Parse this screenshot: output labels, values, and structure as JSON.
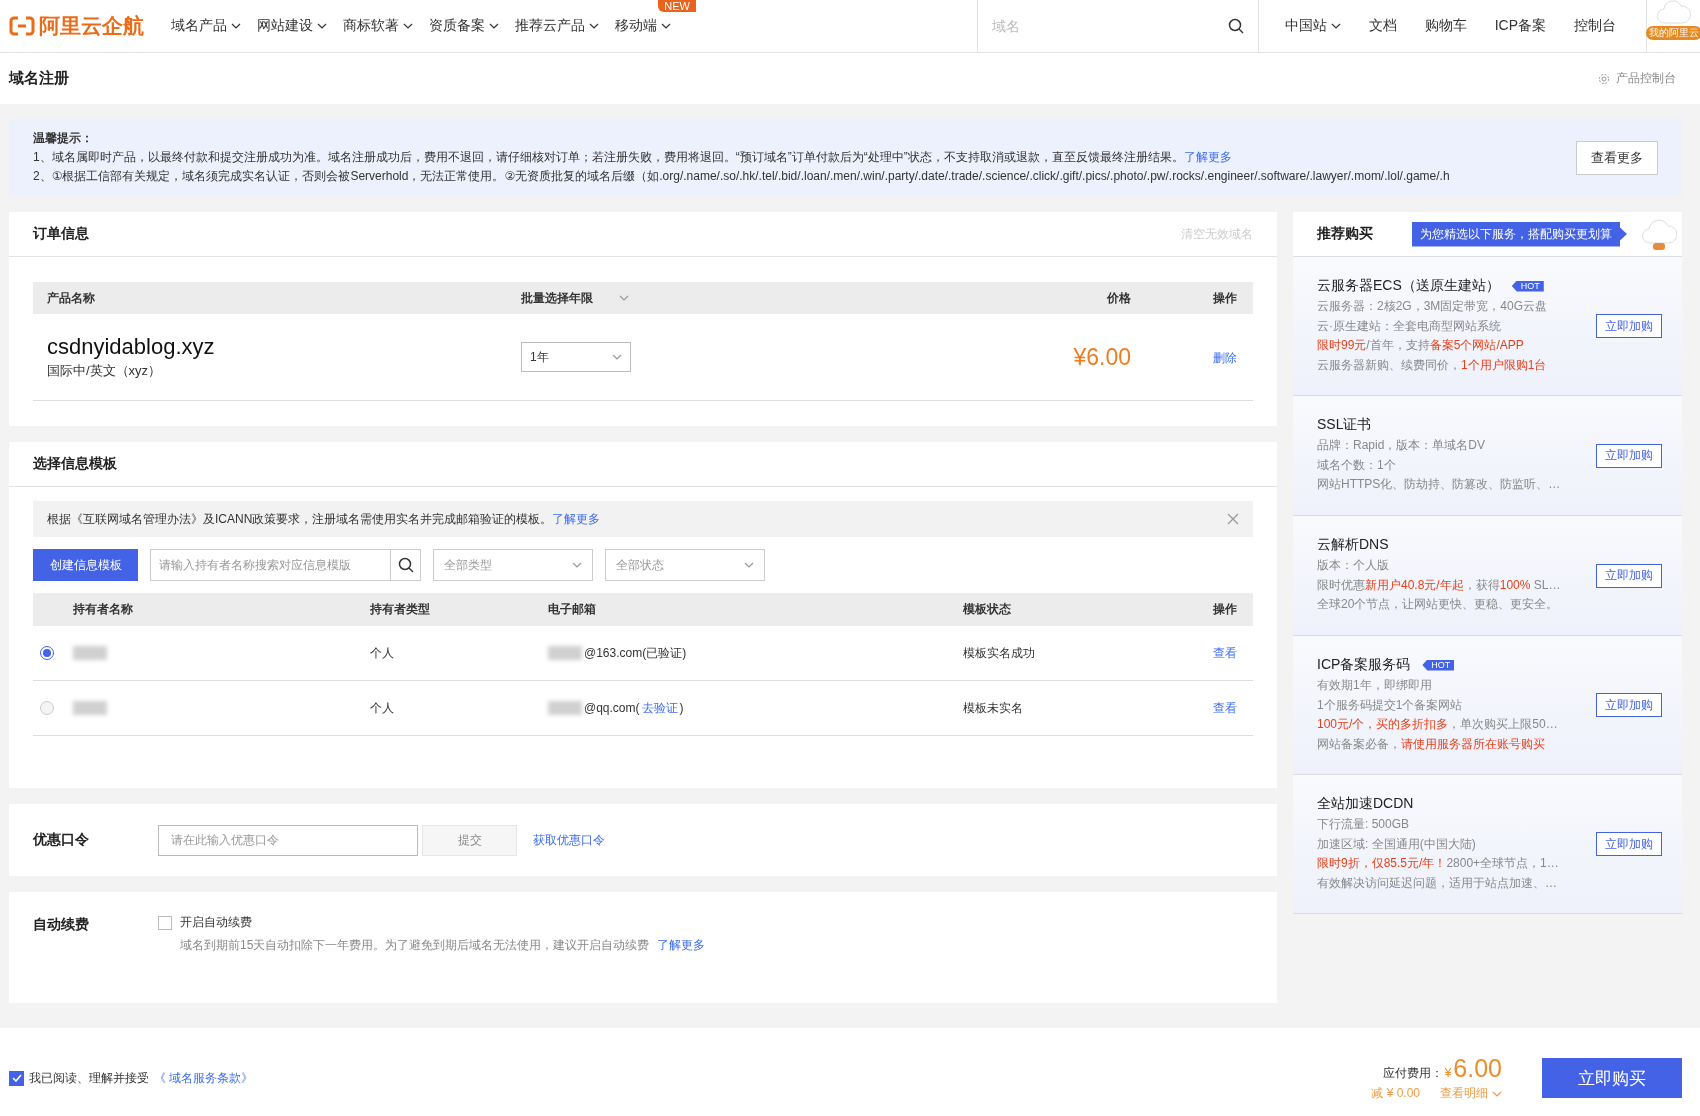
{
  "nav": {
    "logo": "阿里云企航",
    "menu": [
      {
        "label": "域名产品",
        "dropdown": true
      },
      {
        "label": "网站建设",
        "dropdown": true
      },
      {
        "label": "商标软著",
        "dropdown": true
      },
      {
        "label": "资质备案",
        "dropdown": true
      },
      {
        "label": "推荐云产品",
        "dropdown": true
      },
      {
        "label": "移动端",
        "dropdown": true,
        "badge": "NEW"
      }
    ],
    "search": {
      "placeholder": "域名"
    },
    "links": [
      {
        "label": "中国站",
        "dropdown": true
      },
      {
        "label": "文档",
        "dropdown": false
      },
      {
        "label": "购物车",
        "dropdown": false
      },
      {
        "label": "ICP备案",
        "dropdown": false
      },
      {
        "label": "控制台",
        "dropdown": false
      }
    ],
    "avatar_label": "我的阿里云"
  },
  "page_header": {
    "title": "域名注册",
    "console_link": "产品控制台"
  },
  "notice": {
    "title": "温馨提示：",
    "lines": [
      {
        "text": "1、域名属即时产品，以最终付款和提交注册成功为准。域名注册成功后，费用不退回，请仔细核对订单；若注册失败，费用将退回。“预订域名”订单付款后为“处理中”状态，不支持取消或退款，直至反馈最终注册结果。",
        "link": "了解更多"
      },
      {
        "text": "2、①根据工信部有关规定，域名须完成实名认证，否则会被Serverhold，无法正常使用。②无资质批复的域名后缀（如.org/.name/.so/.hk/.tel/.bid/.loan/.men/.win/.party/.date/.trade/.science/.click/.gift/.pics/.photo/.pw/.rocks/.engineer/.software/.lawyer/.mom/.lol/.game/.h"
      }
    ],
    "button": "查看更多"
  },
  "order": {
    "title": "订单信息",
    "clear_link": "清空无效域名",
    "columns": [
      "产品名称",
      "批量选择年限",
      "价格",
      "操作"
    ],
    "rows": [
      {
        "domain": "csdnyidablog.xyz",
        "type": "国际中/英文（xyz）",
        "period": "1年",
        "price": "¥6.00",
        "action": "删除"
      }
    ]
  },
  "template": {
    "title": "选择信息模板",
    "tip": "根据《互联网域名管理办法》及ICANN政策要求，注册域名需使用实名并完成邮箱验证的模板。",
    "tip_link": "了解更多",
    "create_button": "创建信息模板",
    "search_placeholder": "请输入持有者名称搜索对应信息模版",
    "type_filter": "全部类型",
    "status_filter": "全部状态",
    "columns": [
      "持有者名称",
      "持有者类型",
      "电子邮箱",
      "模板状态",
      "操作"
    ],
    "rows": [
      {
        "selected": true,
        "holder_type": "个人",
        "email": "@163.com(已验证)",
        "status": "模板实名成功",
        "action": "查看"
      },
      {
        "selected": false,
        "holder_type": "个人",
        "email": "@qq.com(",
        "email_link": "去验证",
        "email_suffix": ")",
        "status": "模板未实名",
        "action": "查看"
      }
    ]
  },
  "coupon": {
    "label": "优惠口令",
    "placeholder": "请在此输入优惠口令",
    "submit": "提交",
    "submit_disabled": true,
    "link": "获取优惠口令"
  },
  "auto_renew": {
    "label": "自动续费",
    "checkbox": "开启自动续费",
    "checked": false,
    "hint": "域名到期前15天自动扣除下一年费用。为了避免到期后域名无法使用，建议开启自动续费",
    "link": "了解更多"
  },
  "recommend": {
    "title": "推荐购买",
    "banner": "为您精选以下服务，搭配购买更划算",
    "items": [
      {
        "name": "云服务器ECS（送原生建站）",
        "badge": "HOT",
        "button": "立即加购",
        "lines": [
          [
            {
              "text": "云服务器：2核2G，3M固定带宽，40G云盘",
              "highlight": false
            }
          ],
          [
            {
              "text": "云·原生建站：全套电商型网站系统",
              "highlight": false
            }
          ],
          [
            {
              "text": "限时99元",
              "highlight": true
            },
            {
              "text": "/首年，支持",
              "highlight": false
            },
            {
              "text": "备案5个网站/APP",
              "highlight": true
            }
          ],
          [
            {
              "text": "云服务器新购、续费同价，",
              "highlight": false
            },
            {
              "text": "1个用户限购1台",
              "highlight": true
            }
          ]
        ]
      },
      {
        "name": "SSL证书",
        "button": "立即加购",
        "lines": [
          [
            {
              "text": "品牌：Rapid，版本：单域名DV",
              "highlight": false
            }
          ],
          [
            {
              "text": "域名个数：1个",
              "highlight": false
            }
          ],
          [
            {
              "text": "网站HTTPS化、防劫持、防篡改、防监听、…",
              "highlight": false
            }
          ]
        ]
      },
      {
        "name": "云解析DNS",
        "button": "立即加购",
        "lines": [
          [
            {
              "text": "版本：个人版",
              "highlight": false
            }
          ],
          [
            {
              "text": "限时优惠",
              "highlight": false
            },
            {
              "text": "新用户40.8元/年起",
              "highlight": true
            },
            {
              "text": "，获得",
              "highlight": false
            },
            {
              "text": "100%",
              "highlight": true
            },
            {
              "text": " SL…",
              "highlight": false
            }
          ],
          [
            {
              "text": "全球20个节点，让网站更快、更稳、更安全。",
              "highlight": false
            }
          ]
        ]
      },
      {
        "name": "ICP备案服务码",
        "badge": "HOT",
        "button": "立即加购",
        "lines": [
          [
            {
              "text": "有效期1年，即绑即用",
              "highlight": false
            }
          ],
          [
            {
              "text": "1个服务码提交1个备案网站",
              "highlight": false
            }
          ],
          [
            {
              "text": "100元/个，买的多折扣多",
              "highlight": true
            },
            {
              "text": "，单次购买上限50…",
              "highlight": false
            }
          ],
          [
            {
              "text": "网站备案必备，",
              "highlight": false
            },
            {
              "text": "请使用服务器所在账号购买",
              "highlight": true
            }
          ]
        ]
      },
      {
        "name": "全站加速DCDN",
        "button": "立即加购",
        "lines": [
          [
            {
              "text": "下行流量: 500GB",
              "highlight": false
            }
          ],
          [
            {
              "text": "加速区域: 全国通用(中国大陆)",
              "highlight": false
            }
          ],
          [
            {
              "text": "限时9折，仅85.5元/年！",
              "highlight": true
            },
            {
              "text": "2800+全球节点，1…",
              "highlight": false
            }
          ],
          [
            {
              "text": "有效解决访问延迟问题，适用于站点加速、…",
              "highlight": false
            }
          ]
        ]
      }
    ]
  },
  "footer": {
    "agree_checked": true,
    "agree_text": "我已阅读、理解并接受",
    "agree_link": "《 域名服务条款》",
    "total_label": "应付费用：",
    "currency": "¥",
    "total": "6.00",
    "discount": "减 ¥ 0.00",
    "detail": "查看明细",
    "buy": "立即购买"
  }
}
